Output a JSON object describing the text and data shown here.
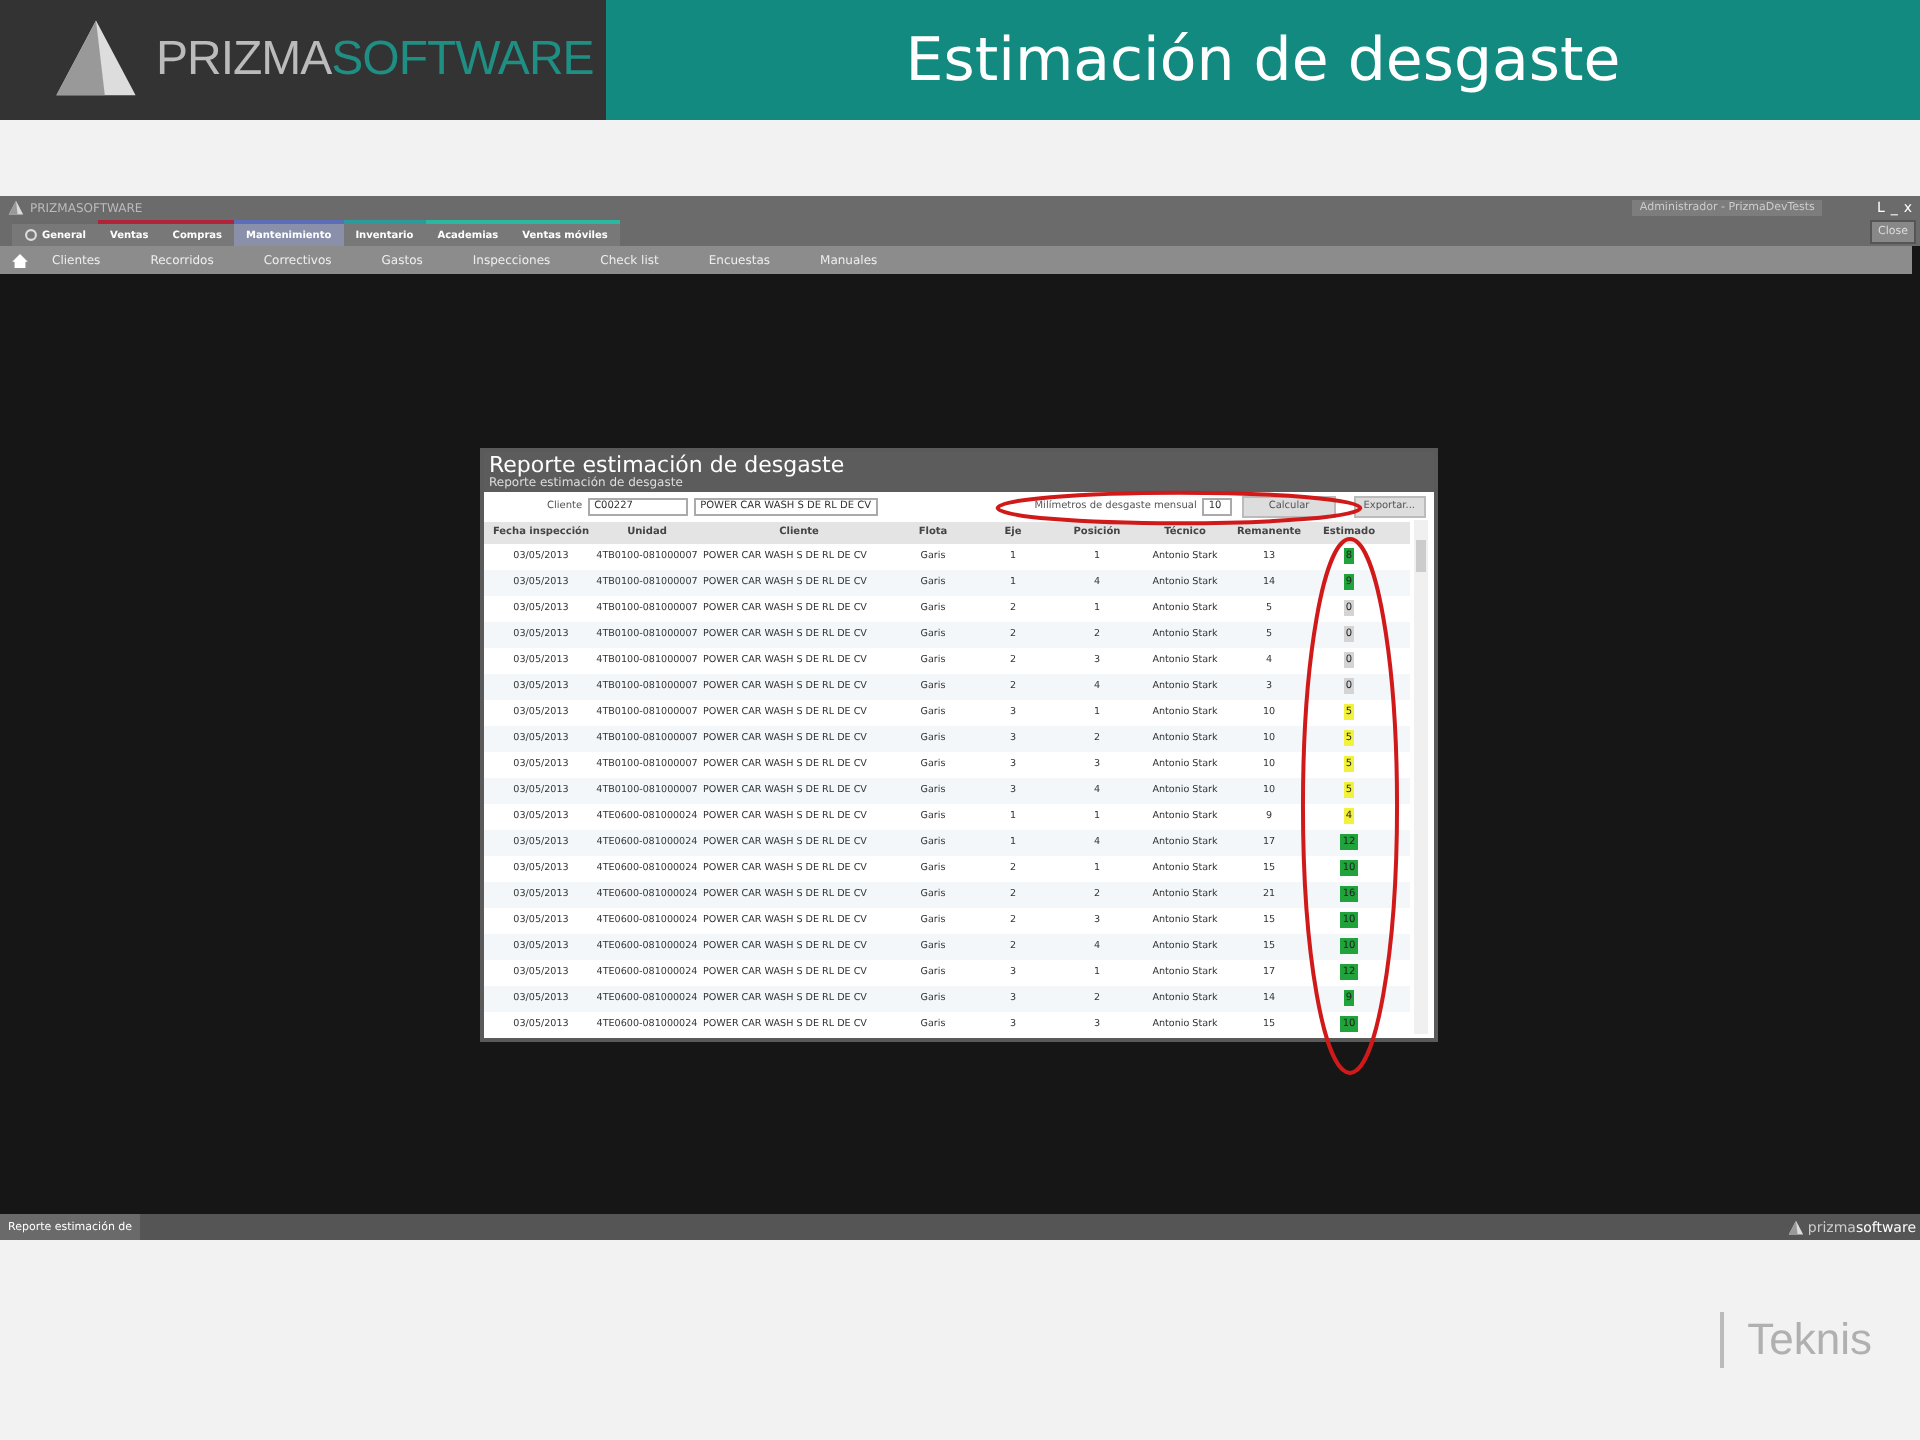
{
  "slide": {
    "logo": {
      "part_1": "PRIZMA",
      "part_2": "SOFTWARE"
    },
    "title": "Estimación de desgaste",
    "footer_brand": "Teknis"
  },
  "app": {
    "logo": "PRIZMASOFTWARE",
    "user": "Administrador - PrizmaDevTests",
    "window_controls": [
      "L",
      "_",
      "x"
    ],
    "close_tooltip": "Close",
    "ribbon_tabs": [
      {
        "label": "General",
        "selected": false,
        "color": "#6a6a6a"
      },
      {
        "label": "Ventas",
        "selected": false,
        "color": "#b0243a"
      },
      {
        "label": "Compras",
        "selected": false,
        "color": "#b0243a"
      },
      {
        "label": "Mantenimiento",
        "selected": true,
        "color": "#5a6fb8"
      },
      {
        "label": "Inventario",
        "selected": false,
        "color": "#2a9a9a"
      },
      {
        "label": "Academias",
        "selected": false,
        "color": "#2ab8a0"
      },
      {
        "label": "Ventas móviles",
        "selected": false,
        "color": "#2ab8a0"
      }
    ],
    "nav_items": [
      "Clientes",
      "Recorridos",
      "Correctivos",
      "Gastos",
      "Inspecciones",
      "Check list",
      "Encuestas",
      "Manuales"
    ],
    "dialog": {
      "title": "Reporte estimación de desgaste",
      "subtitle": "Reporte estimación de desgaste",
      "client_label": "Cliente",
      "client_code": "C00227",
      "client_name": "POWER CAR WASH S DE RL DE CV",
      "mm_label": "Milímetros de desgaste mensual",
      "mm_value": "10",
      "calc_button": "Calcular",
      "export_button": "Exportar...",
      "columns": [
        "Fecha inspección",
        "Unidad",
        "Cliente",
        "Flota",
        "Eje",
        "Posición",
        "Técnico",
        "Remanente",
        "Estimado"
      ],
      "rows": [
        {
          "cells": [
            "03/05/2013",
            "4TB0100-081000007",
            "POWER CAR WASH S DE RL DE CV",
            "Garis",
            "1",
            "1",
            "Antonio Stark",
            "13"
          ],
          "estimate": "8",
          "color": "#1fa33a"
        },
        {
          "cells": [
            "03/05/2013",
            "4TB0100-081000007",
            "POWER CAR WASH S DE RL DE CV",
            "Garis",
            "1",
            "4",
            "Antonio Stark",
            "14"
          ],
          "estimate": "9",
          "color": "#1fa33a"
        },
        {
          "cells": [
            "03/05/2013",
            "4TB0100-081000007",
            "POWER CAR WASH S DE RL DE CV",
            "Garis",
            "2",
            "1",
            "Antonio Stark",
            "5"
          ],
          "estimate": "0",
          "color": "#d4d4d4"
        },
        {
          "cells": [
            "03/05/2013",
            "4TB0100-081000007",
            "POWER CAR WASH S DE RL DE CV",
            "Garis",
            "2",
            "2",
            "Antonio Stark",
            "5"
          ],
          "estimate": "0",
          "color": "#d4d4d4"
        },
        {
          "cells": [
            "03/05/2013",
            "4TB0100-081000007",
            "POWER CAR WASH S DE RL DE CV",
            "Garis",
            "2",
            "3",
            "Antonio Stark",
            "4"
          ],
          "estimate": "0",
          "color": "#d4d4d4"
        },
        {
          "cells": [
            "03/05/2013",
            "4TB0100-081000007",
            "POWER CAR WASH S DE RL DE CV",
            "Garis",
            "2",
            "4",
            "Antonio Stark",
            "3"
          ],
          "estimate": "0",
          "color": "#d4d4d4"
        },
        {
          "cells": [
            "03/05/2013",
            "4TB0100-081000007",
            "POWER CAR WASH S DE RL DE CV",
            "Garis",
            "3",
            "1",
            "Antonio Stark",
            "10"
          ],
          "estimate": "5",
          "color": "#f2f23c"
        },
        {
          "cells": [
            "03/05/2013",
            "4TB0100-081000007",
            "POWER CAR WASH S DE RL DE CV",
            "Garis",
            "3",
            "2",
            "Antonio Stark",
            "10"
          ],
          "estimate": "5",
          "color": "#f2f23c"
        },
        {
          "cells": [
            "03/05/2013",
            "4TB0100-081000007",
            "POWER CAR WASH S DE RL DE CV",
            "Garis",
            "3",
            "3",
            "Antonio Stark",
            "10"
          ],
          "estimate": "5",
          "color": "#f2f23c"
        },
        {
          "cells": [
            "03/05/2013",
            "4TB0100-081000007",
            "POWER CAR WASH S DE RL DE CV",
            "Garis",
            "3",
            "4",
            "Antonio Stark",
            "10"
          ],
          "estimate": "5",
          "color": "#f2f23c"
        },
        {
          "cells": [
            "03/05/2013",
            "4TE0600-081000024",
            "POWER CAR WASH S DE RL DE CV",
            "Garis",
            "1",
            "1",
            "Antonio Stark",
            "9"
          ],
          "estimate": "4",
          "color": "#f2f23c"
        },
        {
          "cells": [
            "03/05/2013",
            "4TE0600-081000024",
            "POWER CAR WASH S DE RL DE CV",
            "Garis",
            "1",
            "4",
            "Antonio Stark",
            "17"
          ],
          "estimate": "12",
          "color": "#1fa33a"
        },
        {
          "cells": [
            "03/05/2013",
            "4TE0600-081000024",
            "POWER CAR WASH S DE RL DE CV",
            "Garis",
            "2",
            "1",
            "Antonio Stark",
            "15"
          ],
          "estimate": "10",
          "color": "#1fa33a"
        },
        {
          "cells": [
            "03/05/2013",
            "4TE0600-081000024",
            "POWER CAR WASH S DE RL DE CV",
            "Garis",
            "2",
            "2",
            "Antonio Stark",
            "21"
          ],
          "estimate": "16",
          "color": "#1fa33a"
        },
        {
          "cells": [
            "03/05/2013",
            "4TE0600-081000024",
            "POWER CAR WASH S DE RL DE CV",
            "Garis",
            "2",
            "3",
            "Antonio Stark",
            "15"
          ],
          "estimate": "10",
          "color": "#1fa33a"
        },
        {
          "cells": [
            "03/05/2013",
            "4TE0600-081000024",
            "POWER CAR WASH S DE RL DE CV",
            "Garis",
            "2",
            "4",
            "Antonio Stark",
            "15"
          ],
          "estimate": "10",
          "color": "#1fa33a"
        },
        {
          "cells": [
            "03/05/2013",
            "4TE0600-081000024",
            "POWER CAR WASH S DE RL DE CV",
            "Garis",
            "3",
            "1",
            "Antonio Stark",
            "17"
          ],
          "estimate": "12",
          "color": "#1fa33a"
        },
        {
          "cells": [
            "03/05/2013",
            "4TE0600-081000024",
            "POWER CAR WASH S DE RL DE CV",
            "Garis",
            "3",
            "2",
            "Antonio Stark",
            "14"
          ],
          "estimate": "9",
          "color": "#1fa33a"
        },
        {
          "cells": [
            "03/05/2013",
            "4TE0600-081000024",
            "POWER CAR WASH S DE RL DE CV",
            "Garis",
            "3",
            "3",
            "Antonio Stark",
            "15"
          ],
          "estimate": "10",
          "color": "#1fa33a"
        }
      ]
    },
    "status_tab": "Reporte estimación de",
    "status_logo": {
      "part_1": "prizma",
      "part_2": "software"
    }
  }
}
